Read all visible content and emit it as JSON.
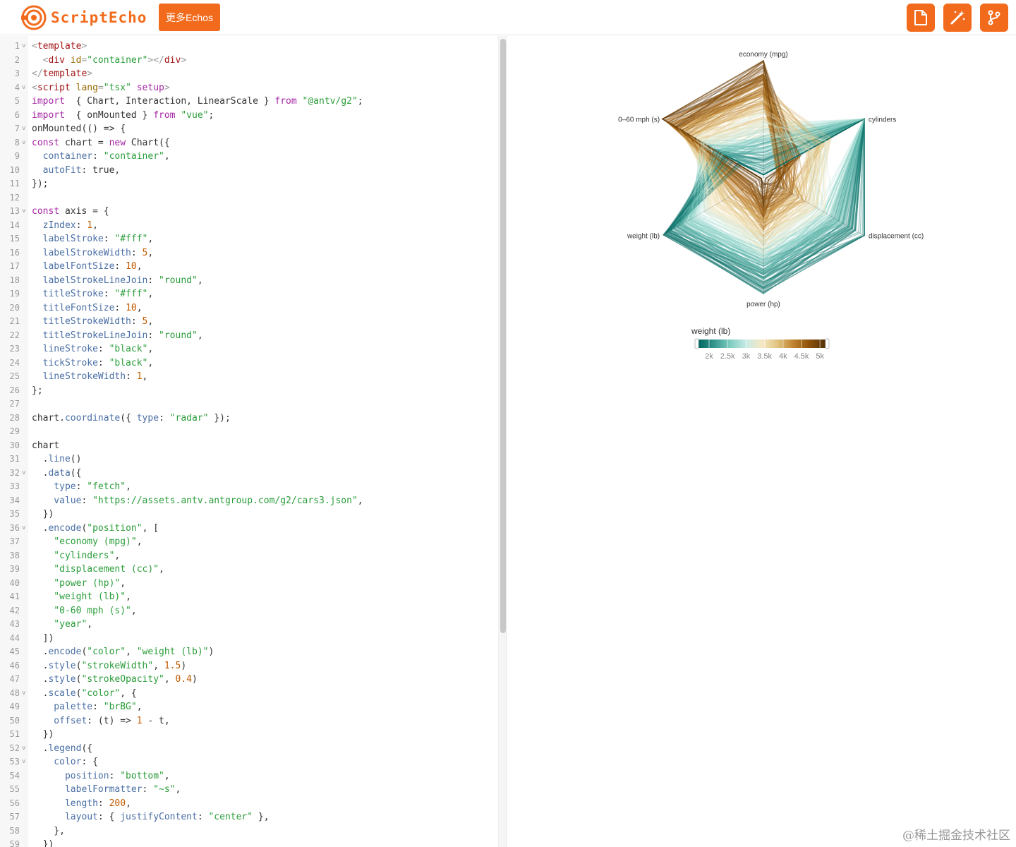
{
  "app": {
    "brand": "ScriptEcho",
    "more_button": "更多Echos",
    "actions": [
      "file-icon",
      "magic-wand-icon",
      "branch-icon"
    ],
    "accent_color": "#f26b1d"
  },
  "editor": {
    "lines": [
      {
        "n": "1",
        "fold": true,
        "tokens": [
          [
            "br",
            "<"
          ],
          [
            "tag",
            "template"
          ],
          [
            "br",
            ">"
          ]
        ]
      },
      {
        "n": "2",
        "tokens": [
          [
            "br",
            "  <"
          ],
          [
            "tag",
            "div"
          ],
          [
            "attr",
            " id"
          ],
          [
            "br",
            "="
          ],
          [
            "str",
            "\"container\""
          ],
          [
            "br",
            "></"
          ],
          [
            "tag",
            "div"
          ],
          [
            "br",
            ">"
          ]
        ]
      },
      {
        "n": "3",
        "tokens": [
          [
            "br",
            "</"
          ],
          [
            "tag",
            "template"
          ],
          [
            "br",
            ">"
          ]
        ]
      },
      {
        "n": "4",
        "fold": true,
        "tokens": [
          [
            "br",
            "<"
          ],
          [
            "tag",
            "script"
          ],
          [
            "attr",
            " lang"
          ],
          [
            "br",
            "="
          ],
          [
            "str",
            "\"tsx\""
          ],
          [
            "kw",
            " setup"
          ],
          [
            "br",
            ">"
          ]
        ]
      },
      {
        "n": "5",
        "tokens": [
          [
            "kw",
            "import"
          ],
          [
            "",
            "  { Chart, Interaction, LinearScale } "
          ],
          [
            "kw",
            "from"
          ],
          [
            "str",
            " \"@antv/g2\""
          ],
          [
            "",
            ";"
          ]
        ]
      },
      {
        "n": "6",
        "tokens": [
          [
            "kw",
            "import"
          ],
          [
            "",
            "  { onMounted } "
          ],
          [
            "kw",
            "from"
          ],
          [
            "str",
            " \"vue\""
          ],
          [
            "",
            ";"
          ]
        ]
      },
      {
        "n": "7",
        "fold": true,
        "tokens": [
          [
            "",
            "onMounted(() => {"
          ]
        ]
      },
      {
        "n": "8",
        "fold": true,
        "tokens": [
          [
            "kw",
            "const"
          ],
          [
            "",
            " chart = "
          ],
          [
            "kw",
            "new"
          ],
          [
            "",
            " Chart({"
          ]
        ]
      },
      {
        "n": "9",
        "tokens": [
          [
            "prop",
            "  container"
          ],
          [
            "",
            ": "
          ],
          [
            "str",
            "\"container\""
          ],
          [
            "",
            ","
          ]
        ]
      },
      {
        "n": "10",
        "tokens": [
          [
            "prop",
            "  autoFit"
          ],
          [
            "",
            ": true,"
          ]
        ]
      },
      {
        "n": "11",
        "tokens": [
          [
            "",
            "});"
          ]
        ]
      },
      {
        "n": "12",
        "tokens": []
      },
      {
        "n": "13",
        "fold": true,
        "tokens": [
          [
            "kw",
            "const"
          ],
          [
            "",
            " axis = {"
          ]
        ]
      },
      {
        "n": "14",
        "tokens": [
          [
            "prop",
            "  zIndex"
          ],
          [
            "",
            ": "
          ],
          [
            "num",
            "1"
          ],
          [
            "",
            ","
          ]
        ]
      },
      {
        "n": "15",
        "tokens": [
          [
            "prop",
            "  labelStroke"
          ],
          [
            "",
            ": "
          ],
          [
            "str",
            "\"#fff\""
          ],
          [
            "",
            ","
          ]
        ]
      },
      {
        "n": "16",
        "tokens": [
          [
            "prop",
            "  labelStrokeWidth"
          ],
          [
            "",
            ": "
          ],
          [
            "num",
            "5"
          ],
          [
            "",
            ","
          ]
        ]
      },
      {
        "n": "17",
        "tokens": [
          [
            "prop",
            "  labelFontSize"
          ],
          [
            "",
            ": "
          ],
          [
            "num",
            "10"
          ],
          [
            "",
            ","
          ]
        ]
      },
      {
        "n": "18",
        "tokens": [
          [
            "prop",
            "  labelStrokeLineJoin"
          ],
          [
            "",
            ": "
          ],
          [
            "str",
            "\"round\""
          ],
          [
            "",
            ","
          ]
        ]
      },
      {
        "n": "19",
        "tokens": [
          [
            "prop",
            "  titleStroke"
          ],
          [
            "",
            ": "
          ],
          [
            "str",
            "\"#fff\""
          ],
          [
            "",
            ","
          ]
        ]
      },
      {
        "n": "20",
        "tokens": [
          [
            "prop",
            "  titleFontSize"
          ],
          [
            "",
            ": "
          ],
          [
            "num",
            "10"
          ],
          [
            "",
            ","
          ]
        ]
      },
      {
        "n": "21",
        "tokens": [
          [
            "prop",
            "  titleStrokeWidth"
          ],
          [
            "",
            ": "
          ],
          [
            "num",
            "5"
          ],
          [
            "",
            ","
          ]
        ]
      },
      {
        "n": "22",
        "tokens": [
          [
            "prop",
            "  titleStrokeLineJoin"
          ],
          [
            "",
            ": "
          ],
          [
            "str",
            "\"round\""
          ],
          [
            "",
            ","
          ]
        ]
      },
      {
        "n": "23",
        "tokens": [
          [
            "prop",
            "  lineStroke"
          ],
          [
            "",
            ": "
          ],
          [
            "str",
            "\"black\""
          ],
          [
            "",
            ","
          ]
        ]
      },
      {
        "n": "24",
        "tokens": [
          [
            "prop",
            "  tickStroke"
          ],
          [
            "",
            ": "
          ],
          [
            "str",
            "\"black\""
          ],
          [
            "",
            ","
          ]
        ]
      },
      {
        "n": "25",
        "tokens": [
          [
            "prop",
            "  lineStrokeWidth"
          ],
          [
            "",
            ": "
          ],
          [
            "num",
            "1"
          ],
          [
            "",
            ","
          ]
        ]
      },
      {
        "n": "26",
        "tokens": [
          [
            "",
            "};"
          ]
        ]
      },
      {
        "n": "27",
        "tokens": []
      },
      {
        "n": "28",
        "tokens": [
          [
            "",
            "chart."
          ],
          [
            "prop",
            "coordinate"
          ],
          [
            "",
            "({ "
          ],
          [
            "prop",
            "type"
          ],
          [
            "",
            ": "
          ],
          [
            "str",
            "\"radar\""
          ],
          [
            "",
            " });"
          ]
        ]
      },
      {
        "n": "29",
        "tokens": []
      },
      {
        "n": "30",
        "tokens": [
          [
            "",
            "chart"
          ]
        ]
      },
      {
        "n": "31",
        "tokens": [
          [
            "",
            "  ."
          ],
          [
            "prop",
            "line"
          ],
          [
            "",
            "()"
          ]
        ]
      },
      {
        "n": "32",
        "fold": true,
        "tokens": [
          [
            "",
            "  ."
          ],
          [
            "prop",
            "data"
          ],
          [
            "",
            "({"
          ]
        ]
      },
      {
        "n": "33",
        "tokens": [
          [
            "prop",
            "    type"
          ],
          [
            "",
            ": "
          ],
          [
            "str",
            "\"fetch\""
          ],
          [
            "",
            ","
          ]
        ]
      },
      {
        "n": "34",
        "tokens": [
          [
            "prop",
            "    value"
          ],
          [
            "",
            ": "
          ],
          [
            "str",
            "\"https://assets.antv.antgroup.com/g2/cars3.json\""
          ],
          [
            "",
            ","
          ]
        ]
      },
      {
        "n": "35",
        "tokens": [
          [
            "",
            "  })"
          ]
        ]
      },
      {
        "n": "36",
        "fold": true,
        "tokens": [
          [
            "",
            "  ."
          ],
          [
            "prop",
            "encode"
          ],
          [
            "",
            "("
          ],
          [
            "str",
            "\"position\""
          ],
          [
            "",
            ", ["
          ]
        ]
      },
      {
        "n": "37",
        "tokens": [
          [
            "str",
            "    \"economy (mpg)\""
          ],
          [
            "",
            ","
          ]
        ]
      },
      {
        "n": "38",
        "tokens": [
          [
            "str",
            "    \"cylinders\""
          ],
          [
            "",
            ","
          ]
        ]
      },
      {
        "n": "39",
        "tokens": [
          [
            "str",
            "    \"displacement (cc)\""
          ],
          [
            "",
            ","
          ]
        ]
      },
      {
        "n": "40",
        "tokens": [
          [
            "str",
            "    \"power (hp)\""
          ],
          [
            "",
            ","
          ]
        ]
      },
      {
        "n": "41",
        "tokens": [
          [
            "str",
            "    \"weight (lb)\""
          ],
          [
            "",
            ","
          ]
        ]
      },
      {
        "n": "42",
        "tokens": [
          [
            "str",
            "    \"0-60 mph (s)\""
          ],
          [
            "",
            ","
          ]
        ]
      },
      {
        "n": "43",
        "tokens": [
          [
            "str",
            "    \"year\""
          ],
          [
            "",
            ","
          ]
        ]
      },
      {
        "n": "44",
        "tokens": [
          [
            "",
            "  ])"
          ]
        ]
      },
      {
        "n": "45",
        "tokens": [
          [
            "",
            "  ."
          ],
          [
            "prop",
            "encode"
          ],
          [
            "",
            "("
          ],
          [
            "str",
            "\"color\""
          ],
          [
            "",
            ", "
          ],
          [
            "str",
            "\"weight (lb)\""
          ],
          [
            "",
            ")"
          ]
        ]
      },
      {
        "n": "46",
        "tokens": [
          [
            "",
            "  ."
          ],
          [
            "prop",
            "style"
          ],
          [
            "",
            "("
          ],
          [
            "str",
            "\"strokeWidth\""
          ],
          [
            "",
            ", "
          ],
          [
            "num",
            "1.5"
          ],
          [
            "",
            ")"
          ]
        ]
      },
      {
        "n": "47",
        "tokens": [
          [
            "",
            "  ."
          ],
          [
            "prop",
            "style"
          ],
          [
            "",
            "("
          ],
          [
            "str",
            "\"strokeOpacity\""
          ],
          [
            "",
            ", "
          ],
          [
            "num",
            "0.4"
          ],
          [
            "",
            ")"
          ]
        ]
      },
      {
        "n": "48",
        "fold": true,
        "tokens": [
          [
            "",
            "  ."
          ],
          [
            "prop",
            "scale"
          ],
          [
            "",
            "("
          ],
          [
            "str",
            "\"color\""
          ],
          [
            "",
            ", {"
          ]
        ]
      },
      {
        "n": "49",
        "tokens": [
          [
            "prop",
            "    palette"
          ],
          [
            "",
            ": "
          ],
          [
            "str",
            "\"brBG\""
          ],
          [
            "",
            ","
          ]
        ]
      },
      {
        "n": "50",
        "tokens": [
          [
            "prop",
            "    offset"
          ],
          [
            "",
            ": (t) => "
          ],
          [
            "num",
            "1"
          ],
          [
            "",
            " - t,"
          ]
        ]
      },
      {
        "n": "51",
        "tokens": [
          [
            "",
            "  })"
          ]
        ]
      },
      {
        "n": "52",
        "fold": true,
        "tokens": [
          [
            "",
            "  ."
          ],
          [
            "prop",
            "legend"
          ],
          [
            "",
            "({"
          ]
        ]
      },
      {
        "n": "53",
        "fold": true,
        "tokens": [
          [
            "prop",
            "    color"
          ],
          [
            "",
            ": {"
          ]
        ]
      },
      {
        "n": "54",
        "tokens": [
          [
            "prop",
            "      position"
          ],
          [
            "",
            ": "
          ],
          [
            "str",
            "\"bottom\""
          ],
          [
            "",
            ","
          ]
        ]
      },
      {
        "n": "55",
        "tokens": [
          [
            "prop",
            "      labelFormatter"
          ],
          [
            "",
            ": "
          ],
          [
            "str",
            "\"~s\""
          ],
          [
            "",
            ","
          ]
        ]
      },
      {
        "n": "56",
        "tokens": [
          [
            "prop",
            "      length"
          ],
          [
            "",
            ": "
          ],
          [
            "num",
            "200"
          ],
          [
            "",
            ","
          ]
        ]
      },
      {
        "n": "57",
        "tokens": [
          [
            "prop",
            "      layout"
          ],
          [
            "",
            ": { "
          ],
          [
            "prop",
            "justifyContent"
          ],
          [
            "",
            ": "
          ],
          [
            "str",
            "\"center\""
          ],
          [
            "",
            " },"
          ]
        ]
      },
      {
        "n": "58",
        "tokens": [
          [
            "",
            "    },"
          ]
        ]
      },
      {
        "n": "59",
        "tokens": [
          [
            "",
            "  })"
          ]
        ]
      }
    ]
  },
  "chart_data": {
    "type": "radar",
    "axes": [
      "economy (mpg)",
      "cylinders",
      "displacement (cc)",
      "power (hp)",
      "weight (lb)",
      "0-60 mph (s)"
    ],
    "axis_labels": [
      "economy (mpg)",
      "cylinders",
      "displacement (cc)",
      "power (hp)",
      "weight (lb)",
      "0–60 mph (s)"
    ],
    "legend": {
      "title": "weight (lb)",
      "ticks": [
        "2k",
        "2.5k",
        "3k",
        "3.5k",
        "4k",
        "4.5k",
        "5k"
      ],
      "palette": [
        "#01665e",
        "#35978f",
        "#80cdc1",
        "#c7eae5",
        "#f6e8c3",
        "#dfc27d",
        "#bf812d",
        "#8c510a",
        "#543005"
      ],
      "placement": "bottom"
    }
  },
  "watermark": "@稀土掘金技术社区"
}
